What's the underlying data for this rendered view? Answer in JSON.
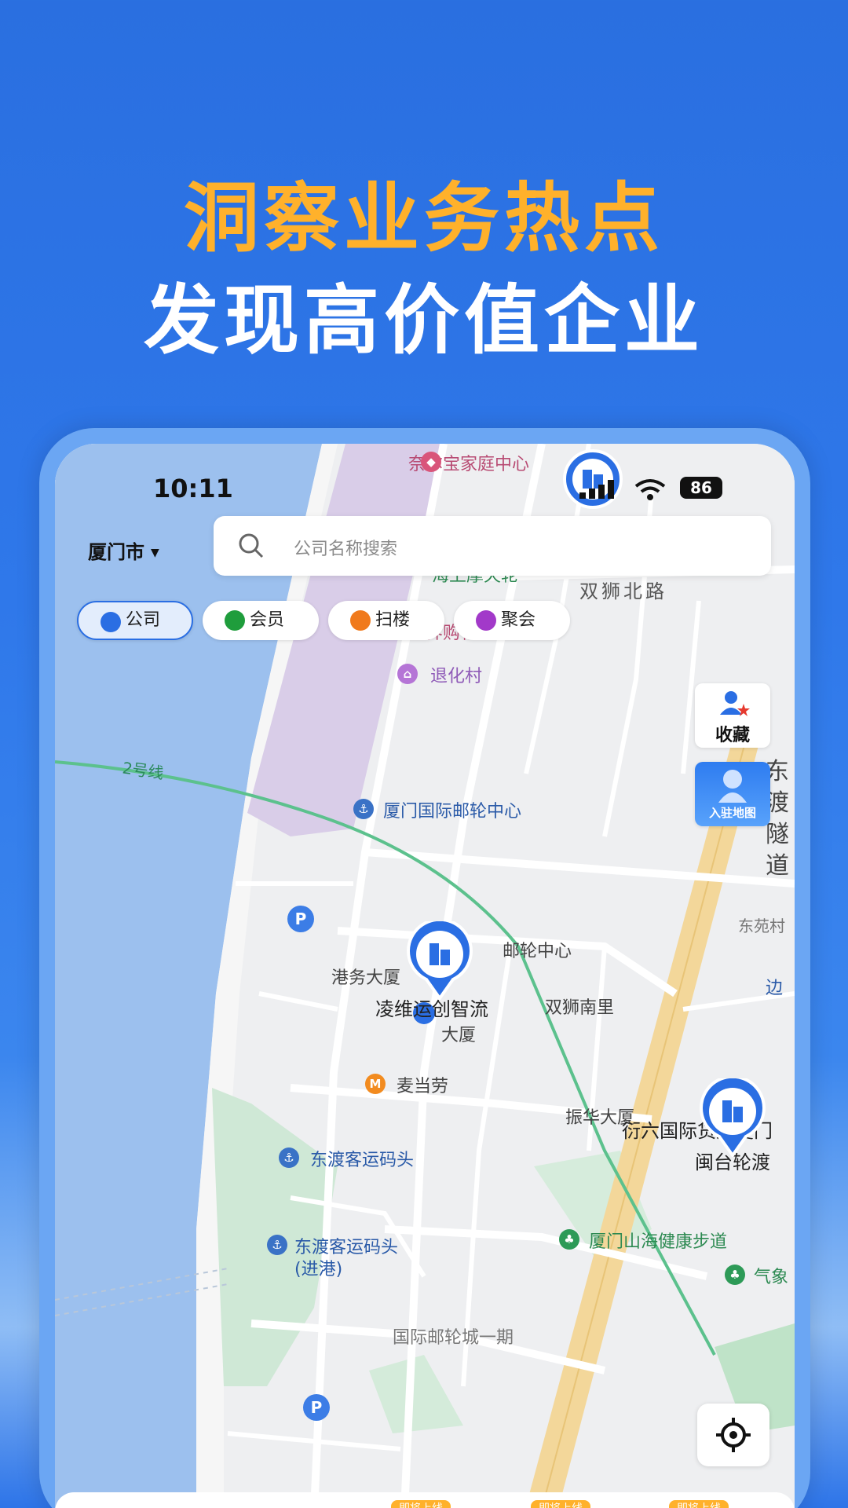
{
  "headline": {
    "line1": "洞察业务热点",
    "line2": "发现高价值企业"
  },
  "status_bar": {
    "time": "10:11",
    "battery": "86"
  },
  "header": {
    "city": "厦门市",
    "search_placeholder": "公司名称搜索"
  },
  "filters": [
    {
      "label": "公司",
      "active": true,
      "icon": "building-icon",
      "color": "#2a6ee3"
    },
    {
      "label": "会员",
      "active": false,
      "icon": "user-icon",
      "color": "#1f9d3c"
    },
    {
      "label": "扫楼",
      "active": false,
      "icon": "scan-building-icon",
      "color": "#f07a1c"
    },
    {
      "label": "聚会",
      "active": false,
      "icon": "gathering-icon",
      "color": "#a239c9"
    }
  ],
  "side_buttons": {
    "favorites": "收藏",
    "join_map": "入驻地图"
  },
  "map": {
    "labels": {
      "naierbao": "奈尔宝家庭中心",
      "haishang": "海上摩天轮",
      "shijie_gouwu": "世界购物中心",
      "shuangshi_bei": "双狮北路",
      "tuihua": "退化村",
      "cruise_center": "厦门国际邮轮中心",
      "line2": "2号线",
      "tunnel": "东渡隧道",
      "dongyuan": "东苑村",
      "cruise_center_short": "邮轮中心",
      "gangwu": "港务大厦",
      "shuangshi_nan": "双狮南里",
      "lingwei": "凌维运创智流",
      "dasha": "大厦",
      "mcd": "麦当劳",
      "zhenhua": "振华大厦",
      "yanliu": "衍六国际货运厦门",
      "mintai": "闽台轮渡",
      "dongdu_pier": "东渡客运码头",
      "dongdu_pier_in": "东渡客运码头",
      "dongdu_pier_in_note": "(进港)",
      "shanhai": "厦门山海健康步道",
      "qixiang": "气象",
      "cruise_city": "国际邮轮城一期",
      "bian": "边"
    }
  },
  "bottom_bar": {
    "soon_labels": [
      "即将上线",
      "即将上线",
      "即将上线"
    ]
  }
}
